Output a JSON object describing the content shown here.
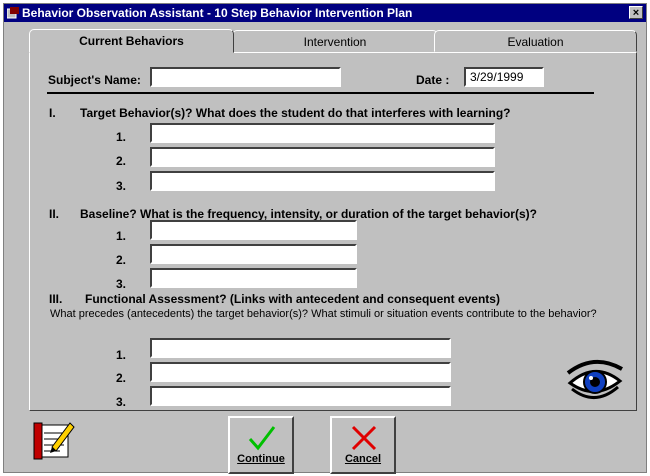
{
  "window": {
    "title": "Behavior Observation Assistant - 10 Step Behavior Intervention Plan",
    "close_glyph": "×"
  },
  "tabs": [
    {
      "label": "Current Behaviors",
      "active": true
    },
    {
      "label": "Intervention",
      "active": false
    },
    {
      "label": "Evaluation",
      "active": false
    }
  ],
  "header": {
    "subject_label": "Subject's Name:",
    "subject_value": "",
    "date_label": "Date :",
    "date_value": "3/29/1999"
  },
  "sections": {
    "target": {
      "num": "I.",
      "question": "Target Behavior(s)?  What does the student do that interferes with learning?",
      "rows": [
        "1.",
        "2.",
        "3."
      ]
    },
    "baseline": {
      "num": "II.",
      "question": "Baseline?  What is the frequency, intensity, or duration of the target behavior(s)?",
      "rows": [
        "1.",
        "2.",
        "3."
      ]
    },
    "functional": {
      "num": "III.",
      "question": "Functional Assessment?  (Links with antecedent and consequent events)",
      "sub": "What precedes (antecedents) the target behavior(s)?  What stimuli or situation events contribute to the behavior?",
      "rows": [
        "1.",
        "2.",
        "3."
      ]
    }
  },
  "buttons": {
    "continue": "Continue",
    "cancel": "Cancel"
  },
  "icons": {
    "app": "app-icon",
    "notebook": "notebook-pencil-icon",
    "eye": "eye-icon",
    "check": "checkmark-icon",
    "x": "red-x-icon"
  },
  "colors": {
    "titlebar": "#000080",
    "face": "#c0c0c0",
    "check": "#00c000",
    "cancel_x": "#e00000",
    "eye_iris": "#1040c0"
  }
}
